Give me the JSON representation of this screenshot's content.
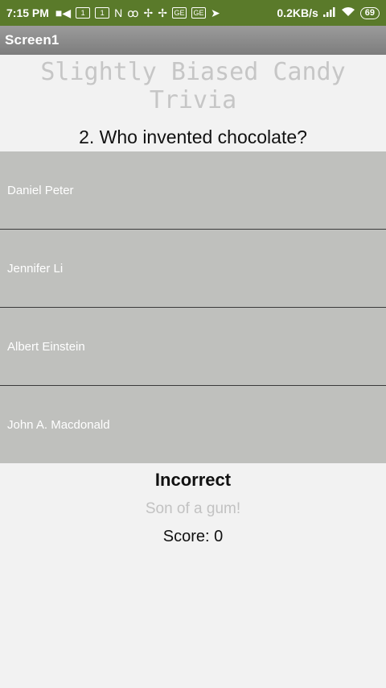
{
  "status_bar": {
    "time": "7:15 PM",
    "network_speed": "0.2KB/s",
    "battery": "69",
    "icons": [
      "video-icon",
      "sim1-icon",
      "sim2-icon",
      "n-icon",
      "voicemail-icon",
      "pinwheel-icon",
      "pinwheel-icon",
      "ge-icon",
      "ge-icon",
      "send-icon",
      "signal-icon",
      "wifi-icon",
      "battery-icon"
    ]
  },
  "app_bar": {
    "title": "Screen1"
  },
  "quiz": {
    "title": "Slightly Biased Candy Trivia",
    "question": "2. Who invented chocolate?",
    "answers": [
      "Daniel Peter",
      "Jennifer Li",
      "Albert Einstein",
      "John A. Macdonald"
    ],
    "result": "Incorrect",
    "feedback": "Son of a gum!",
    "score": "Score: 0"
  },
  "colors": {
    "status_bar_bg": "#5a7a2a",
    "app_bar_bg": "#8a8a8a",
    "answer_bg": "#bfc0bd",
    "title_color": "#c6c6c6"
  }
}
